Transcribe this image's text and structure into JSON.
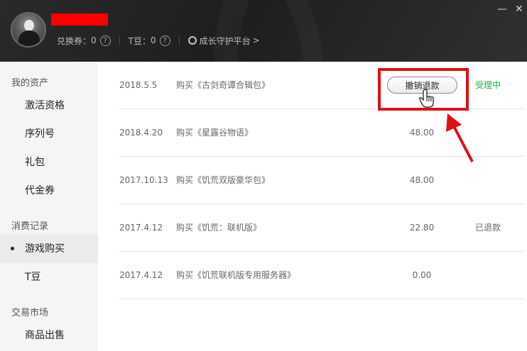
{
  "header": {
    "coupon_label": "兑换券：",
    "coupon_value": "0",
    "tdou_label": "T豆：",
    "tdou_value": "0",
    "help_glyph": "?",
    "growth_label": "成长守护平台",
    "growth_chevron": ">",
    "minimize_glyph": "—",
    "close_glyph": "✕"
  },
  "sidebar": {
    "sections": [
      {
        "title": "我的资产",
        "items": [
          "激活资格",
          "序列号",
          "礼包",
          "代金券"
        ]
      },
      {
        "title": "消费记录",
        "items": [
          "游戏购买",
          "T豆"
        ]
      },
      {
        "title": "交易市场",
        "items": [
          "商品出售"
        ]
      }
    ],
    "active_item": "游戏购买"
  },
  "purchases": [
    {
      "date": "2018.5.5",
      "item": "购买《古剑奇谭合辑包》",
      "price": "",
      "status": "受理中",
      "action": "撤销退款"
    },
    {
      "date": "2018.4.20",
      "item": "购买《星露谷物语》",
      "price": "48.00",
      "status": ""
    },
    {
      "date": "2017.10.13",
      "item": "购买《饥荒双版豪华包》",
      "price": "48.00",
      "status": ""
    },
    {
      "date": "2017.4.12",
      "item": "购买《饥荒：联机版》",
      "price": "22.80",
      "status": "已退款"
    },
    {
      "date": "2017.4.12",
      "item": "购买《饥荒联机版专用服务器》",
      "price": "0.00",
      "status": ""
    }
  ],
  "colors": {
    "pending_status": "#21b24b",
    "annotation_red": "#e01010",
    "redaction": "#ff0000"
  },
  "icons": {
    "minimize": "minimize-icon",
    "close": "close-icon",
    "help": "help-icon",
    "growth": "growth-platform-icon",
    "cursor": "hand-cursor-icon",
    "annotation_arrow": "annotation-arrow-icon"
  }
}
